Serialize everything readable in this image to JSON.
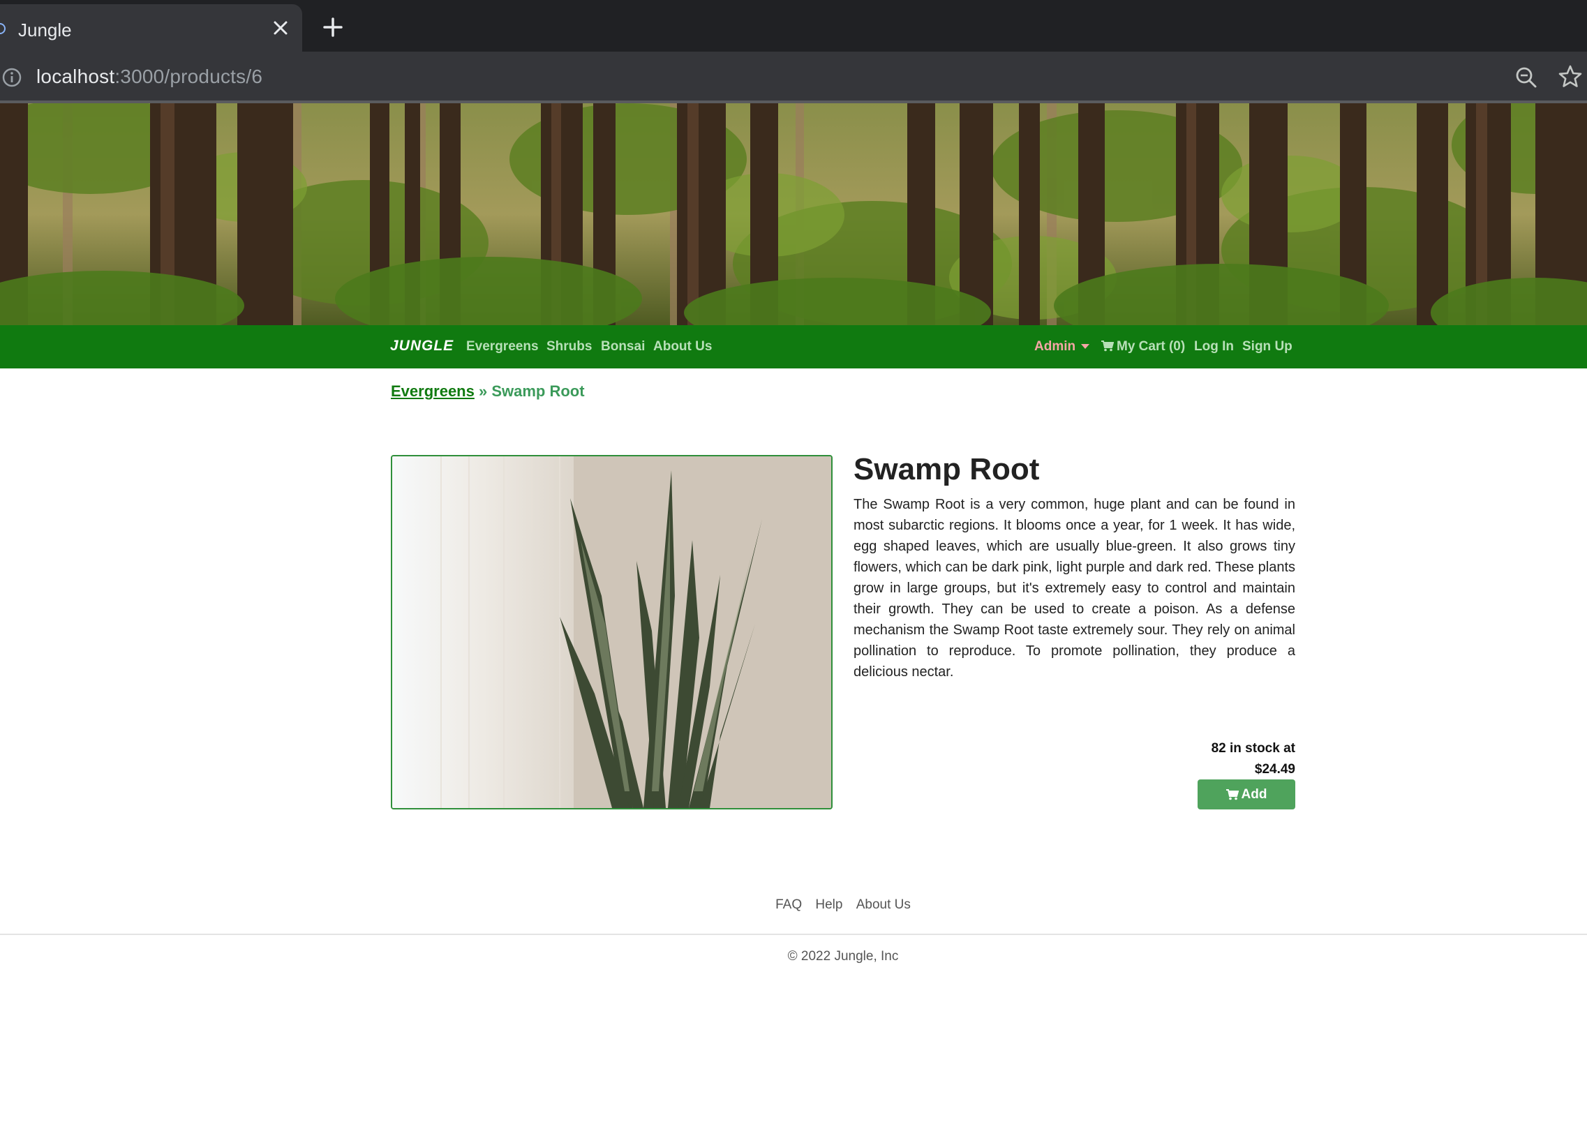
{
  "browser": {
    "tab_title": "Jungle",
    "url_host": "localhost",
    "url_path": ":3000/products/6"
  },
  "navbar": {
    "brand": "JUNGLE",
    "links": [
      "Evergreens",
      "Shrubs",
      "Bonsai",
      "About Us"
    ],
    "admin": "Admin",
    "cart": "My Cart (0)",
    "login": "Log In",
    "signup": "Sign Up"
  },
  "breadcrumb": {
    "category": "Evergreens",
    "separator": " » ",
    "current": "Swamp Root"
  },
  "product": {
    "name": "Swamp Root",
    "description": "The Swamp Root is a very common, huge plant and can be found in most subarctic regions. It blooms once a year, for 1 week. It has wide, egg shaped leaves, which are usually blue-green. It also grows tiny flowers, which can be dark pink, light purple and dark red. These plants grow in large groups, but it's extremely easy to control and maintain their growth. They can be used to create a poison. As a defense mechanism the Swamp Root taste extremely sour. They rely on animal pollination to reproduce. To promote pollination, they produce a delicious nectar.",
    "stock_text": "82 in stock at",
    "price": "$24.49",
    "add_label": "Add"
  },
  "footer": {
    "links": [
      "FAQ",
      "Help",
      "About Us"
    ],
    "copyright": "© 2022 Jungle, Inc"
  },
  "colors": {
    "navbar": "#107a10",
    "button": "#4fa35c",
    "admin": "#f6a6a6",
    "chrome": "#202124"
  }
}
